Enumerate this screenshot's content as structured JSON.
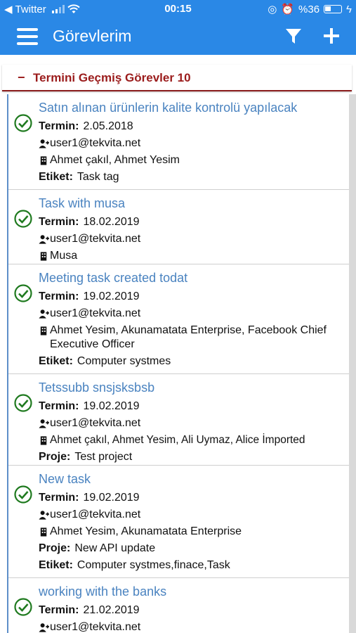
{
  "status_bar": {
    "carrier": "Twitter",
    "time": "00:15",
    "battery": "%36"
  },
  "app_bar": {
    "title": "Görevlerim"
  },
  "section": {
    "title": "Termini Geçmiş Görevler 10"
  },
  "labels": {
    "due": "Termin:",
    "tag": "Etiket:",
    "project": "Proje:"
  },
  "tasks": [
    {
      "title": "Satın alınan ürünlerin kalite kontrolü yapılacak",
      "due": "2.05.2018",
      "owner": "user1@tekvita.net",
      "assignees": "Ahmet çakıl, Ahmet Yesim",
      "tag": "Task tag"
    },
    {
      "title": "Task with musa",
      "due": "18.02.2019",
      "owner": "user1@tekvita.net",
      "assignees": "Musa"
    },
    {
      "title": "Meeting task created todat",
      "due": "19.02.2019",
      "owner": "user1@tekvita.net",
      "assignees": "Ahmet Yesim, Akunamatata Enterprise, Facebook Chief Executive Officer",
      "tag": "Computer systmes"
    },
    {
      "title": "Tetssubb snsjsksbsb",
      "due": "19.02.2019",
      "owner": "user1@tekvita.net",
      "assignees": "Ahmet çakıl, Ahmet Yesim, Ali Uymaz, Alice İmported",
      "project": "Test project"
    },
    {
      "title": "New task",
      "due": "19.02.2019",
      "owner": "user1@tekvita.net",
      "assignees": "Ahmet Yesim, Akunamatata Enterprise",
      "project": "New API update",
      "tag": "Computer systmes,finace,Task"
    },
    {
      "title": "working with the banks",
      "due": "21.02.2019",
      "owner": "user1@tekvita.net"
    }
  ],
  "colors": {
    "primary": "#2a88e6",
    "section_accent": "#9b1c1c",
    "task_title": "#4a83c0",
    "check_green": "#1f7a1f"
  }
}
